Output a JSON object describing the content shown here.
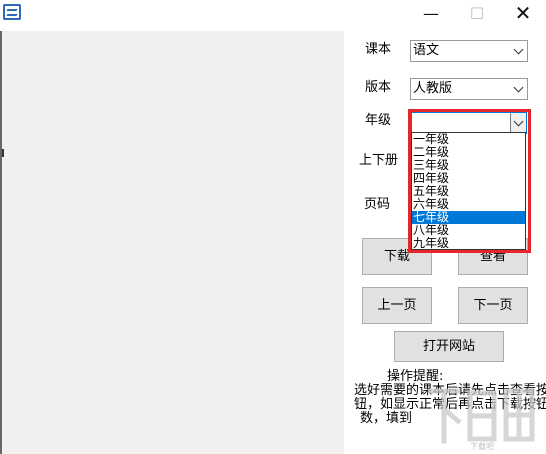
{
  "window": {
    "minimize_glyph": "—",
    "maximize_glyph": "☐",
    "close_glyph": "✕"
  },
  "fields": {
    "textbook_label": "课本",
    "textbook_value": "语文",
    "edition_label": "版本",
    "edition_value": "人教版",
    "grade_label": "年级",
    "grade_value": "",
    "volume_label": "上下册",
    "page_label": "页码"
  },
  "grade_options": [
    "一年级",
    "二年级",
    "三年级",
    "四年级",
    "五年级",
    "六年级",
    "七年级",
    "八年级",
    "九年级"
  ],
  "grade_highlighted_index": 6,
  "buttons": {
    "download": "下载",
    "view": "查看",
    "prev_page": "上一页",
    "next_page": "下一页",
    "open_website": "打开网站"
  },
  "hint": {
    "title": "操作提醒:",
    "line1": "选好需要的课本后请先点击查看按",
    "line2": "钮，如显示正常后再点击下载按钮，",
    "line3": "数，填到"
  },
  "watermark": "下载吧",
  "colors": {
    "highlight_border": "#e6262a",
    "selection": "#0078d7",
    "preview_bg": "#f0f0f0",
    "button_bg": "#e1e1e1"
  }
}
